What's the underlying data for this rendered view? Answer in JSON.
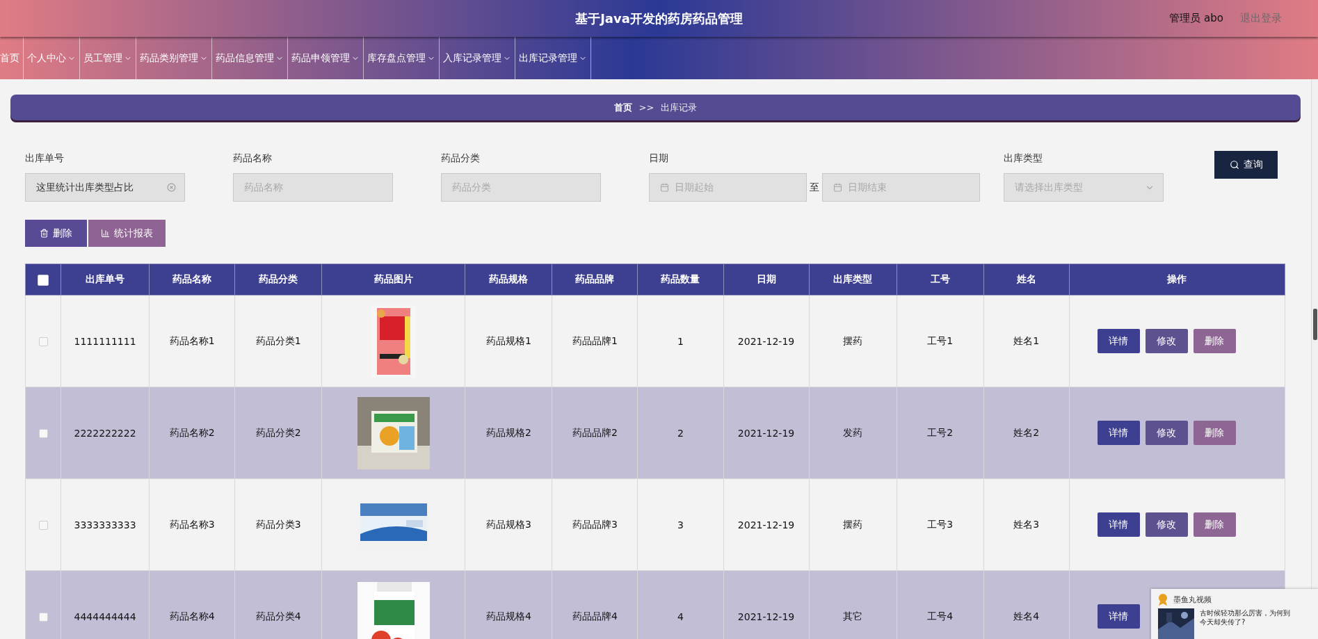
{
  "header": {
    "title": "基于Java开发的药房药品管理",
    "user": "管理员 abo",
    "logout": "退出登录"
  },
  "nav": [
    {
      "label": "首页",
      "dropdown": false
    },
    {
      "label": "个人中心",
      "dropdown": true
    },
    {
      "label": "员工管理",
      "dropdown": true
    },
    {
      "label": "药品类别管理",
      "dropdown": true
    },
    {
      "label": "药品信息管理",
      "dropdown": true
    },
    {
      "label": "药品申领管理",
      "dropdown": true
    },
    {
      "label": "库存盘点管理",
      "dropdown": true
    },
    {
      "label": "入库记录管理",
      "dropdown": true
    },
    {
      "label": "出库记录管理",
      "dropdown": true
    }
  ],
  "breadcrumb": {
    "home": "首页",
    "separator": ">>",
    "current": "出库记录"
  },
  "filters": [
    {
      "kind": "text",
      "label": "出库单号",
      "value": "这里统计出库类型占比"
    },
    {
      "kind": "text",
      "label": "药品名称",
      "placeholder": "药品名称"
    },
    {
      "kind": "text",
      "label": "药品分类",
      "placeholder": "药品分类"
    },
    {
      "kind": "daterange",
      "label": "日期",
      "start_placeholder": "日期起始",
      "to": "至",
      "end_placeholder": "日期结束"
    },
    {
      "kind": "select",
      "label": "出库类型",
      "placeholder": "请选择出库类型"
    }
  ],
  "search_button": "查询",
  "actions": [
    {
      "kind": "delete",
      "label": "删除"
    },
    {
      "kind": "report",
      "label": "统计报表"
    }
  ],
  "table": {
    "select_all_checked": false,
    "columns": [
      "出库单号",
      "药品名称",
      "药品分类",
      "药品图片",
      "药品规格",
      "药品品牌",
      "药品数量",
      "日期",
      "出库类型",
      "工号",
      "姓名",
      "操作"
    ],
    "rows": [
      {
        "checked": false,
        "id": "1111111111",
        "name": "药品名称1",
        "category": "药品分类1",
        "picture": {
          "kind": "picture"
        },
        "spec": "药品规格1",
        "brand": "药品品牌1",
        "qty": "1",
        "date": "2021-12-19",
        "type": "摆药",
        "staff_no": "工号1",
        "staff_name": "姓名1",
        "buttons": [
          {
            "kind": "detail",
            "label": "详情"
          },
          {
            "kind": "edit",
            "label": "修改"
          },
          {
            "kind": "delete",
            "label": "删除"
          }
        ]
      },
      {
        "checked": false,
        "id": "2222222222",
        "name": "药品名称2",
        "category": "药品分类2",
        "picture": {
          "kind": "picture"
        },
        "spec": "药品规格2",
        "brand": "药品品牌2",
        "qty": "2",
        "date": "2021-12-19",
        "type": "发药",
        "staff_no": "工号2",
        "staff_name": "姓名2",
        "buttons": [
          {
            "kind": "detail",
            "label": "详情"
          },
          {
            "kind": "edit",
            "label": "修改"
          },
          {
            "kind": "delete",
            "label": "删除"
          }
        ]
      },
      {
        "checked": false,
        "id": "3333333333",
        "name": "药品名称3",
        "category": "药品分类3",
        "picture": {
          "kind": "picture"
        },
        "spec": "药品规格3",
        "brand": "药品品牌3",
        "qty": "3",
        "date": "2021-12-19",
        "type": "摆药",
        "staff_no": "工号3",
        "staff_name": "姓名3",
        "buttons": [
          {
            "kind": "detail",
            "label": "详情"
          },
          {
            "kind": "edit",
            "label": "修改"
          },
          {
            "kind": "delete",
            "label": "删除"
          }
        ]
      },
      {
        "checked": false,
        "id": "4444444444",
        "name": "药品名称4",
        "category": "药品分类4",
        "picture": {
          "kind": "picture"
        },
        "spec": "药品规格4",
        "brand": "药品品牌4",
        "qty": "4",
        "date": "2021-12-19",
        "type": "其它",
        "staff_no": "工号4",
        "staff_name": "姓名4",
        "buttons": [
          {
            "kind": "detail",
            "label": "详情"
          }
        ]
      }
    ]
  },
  "popup": {
    "source": "墨鱼丸视频",
    "lines": [
      "古时候轻功那么厉害，为何到",
      "今天却失传了?"
    ]
  }
}
